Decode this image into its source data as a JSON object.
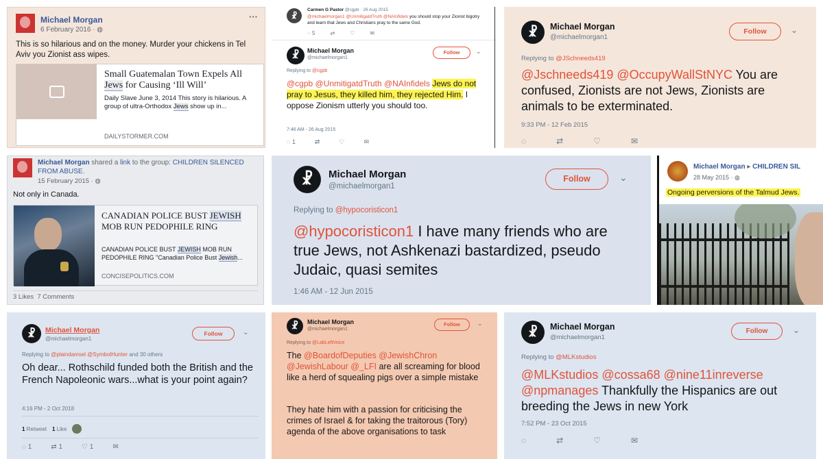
{
  "colors": {
    "fb_bg": "#f5e6dc",
    "tw_accent": "#e0533a",
    "highlight": "#fff44f",
    "panel_blue": "#dbe2ee"
  },
  "p1": {
    "name": "Michael Morgan",
    "date": "6 February 2016 · ",
    "more": "···",
    "text": "This is so hilarious and on the money. Murder your chickens in Tel Aviv you Zionist ass wipes.",
    "link_title_a": "Small Guatemalan Town Expels All ",
    "link_title_jews": "Jews",
    "link_title_b": " for Causing ‘Ill Will’",
    "link_desc_a": "Daily Slave June 3, 2014 This story is hilarious.  A group of ultra-Orthodox ",
    "link_desc_jews": "Jews",
    "link_desc_b": " show up in...",
    "domain": "DAILYSTORMER.COM",
    "icon": "image-placeholder-icon"
  },
  "p2": {
    "reply_name": "Carmen G Pastor",
    "reply_handle": " @cgpb · 26 Aug 2015",
    "reply_mentions": "@michaelmorgan1 @UnmitigatdTruth @NAInfidels",
    "reply_text": " you should stop your Zionist bigotry and learn that Jews and Christians pray to the same God.",
    "reply_count": "5",
    "name": "Michael Morgan",
    "handle": "@michaelmorgan1",
    "follow": "Follow",
    "replying_prefix": "Replying to ",
    "replying_to": "@cgpb",
    "mentions": "@cgpb @UnmitigatdTruth @NAInfidels ",
    "highlight_text": "Jews do not pray to Jesus, they killed him, they rejected Him.",
    "text": " I oppose Zionism utterly you should too.",
    "time": "7:46 AM - 26 Aug 2015",
    "reply_icon_count": "1"
  },
  "p3": {
    "name": "Michael Morgan",
    "handle": "@michaelmorgan1",
    "follow": "Follow",
    "replying_prefix": "Replying to ",
    "replying_to": "@JSchneeds419",
    "mentions": "@Jschneeds419 @OccupyWallStNYC",
    "text": " You are confused, Zionists are not Jews, Zionists are animals to be exterminated.",
    "time": "9:33 PM - 12 Feb 2015"
  },
  "p4": {
    "name": "Michael Morgan",
    "shared": " shared a ",
    "link_word": "link",
    "to_group": " to the group: ",
    "group": "CHILDREN SILENCED FROM ABUSE.",
    "date": "15 February 2015 · ",
    "more": "···",
    "text": "Not only in Canada.",
    "link_title_a": "CANADIAN POLICE BUST ",
    "link_title_jews": "JEWISH",
    "link_title_b": " MOB RUN PEDOPHILE RING",
    "link_desc_a": "CANADIAN POLICE BUST ",
    "link_desc_jews": "JEWISH",
    "link_desc_b": " MOB RUN PEDOPHILE RING \"Canadian Police Bust ",
    "link_desc_jews2": "Jewish",
    "link_desc_c": "...",
    "domain": "CONCISEPOLITICS.COM",
    "footer": "3 Likes  7 Comments"
  },
  "p5": {
    "name": "Michael Morgan",
    "handle": "@michaelmorgan1",
    "follow": "Follow",
    "replying_prefix": "Replying to ",
    "replying_to": "@hypocoristicon1",
    "mentions": "@hypocoristicon1",
    "text": " I have many friends who are true Jews, not Ashkenazi bastardized, pseudo Judaic, quasi semites",
    "time": "1:46 AM - 12 Jun 2015"
  },
  "p6": {
    "name": "Michael Morgan",
    "arrow": " ▸ ",
    "group": "CHILDREN SIL",
    "date": "28 May 2015 · ",
    "highlight_text": "Ongoing perversions of the Talmud Jews."
  },
  "p7": {
    "name": "Michael Morgan",
    "handle": "@michaelmorgan1",
    "follow": "Follow",
    "replying_prefix": "Replying to ",
    "replying_to": "@plaindamsel @SymbolHunter",
    "replying_suffix": " and 30 others",
    "text": "Oh dear... Rothschild funded both the British and the French Napoleonic wars...what is your point again?",
    "time": "4:16 PM - 2 Oct 2018",
    "retweets_n": "1",
    "retweets_label": " Retweet",
    "likes_n": "1",
    "likes_label": " Like",
    "reply_count": "1",
    "rt_count": "1",
    "like_count": "1"
  },
  "p8": {
    "name": "Michael Morgan",
    "handle": "@michaelmorgan1",
    "follow": "Follow",
    "replying_prefix": "Replying to ",
    "replying_to": "@LabLeftVoice",
    "text_a": "The ",
    "mentions": "@BoardofDeputies @JewishChron @JewishLabour @_LFI",
    "text_b": " are all screaming for blood like a herd of squealing pigs over a simple mistake",
    "text_c": "They hate him with a passion for criticising the crimes of Israel & for taking the traitorous (Tory) agenda of the above organisations to task"
  },
  "p9": {
    "name": "Michael Morgan",
    "handle": "@michaelmorgan1",
    "follow": "Follow",
    "replying_prefix": "Replying to ",
    "replying_to": "@MLKstudios",
    "mentions": "@MLKstudios @cossa68 @nine11inreverse @npmanages",
    "text": " Thankfully the Hispanics are out breeding the Jews in new York",
    "time": "7:52 PM - 23 Oct 2015"
  },
  "avatar_glyph": "☧",
  "icons": [
    "reply-icon",
    "retweet-icon",
    "like-icon",
    "message-icon",
    "chevron-down-icon",
    "globe-icon"
  ]
}
